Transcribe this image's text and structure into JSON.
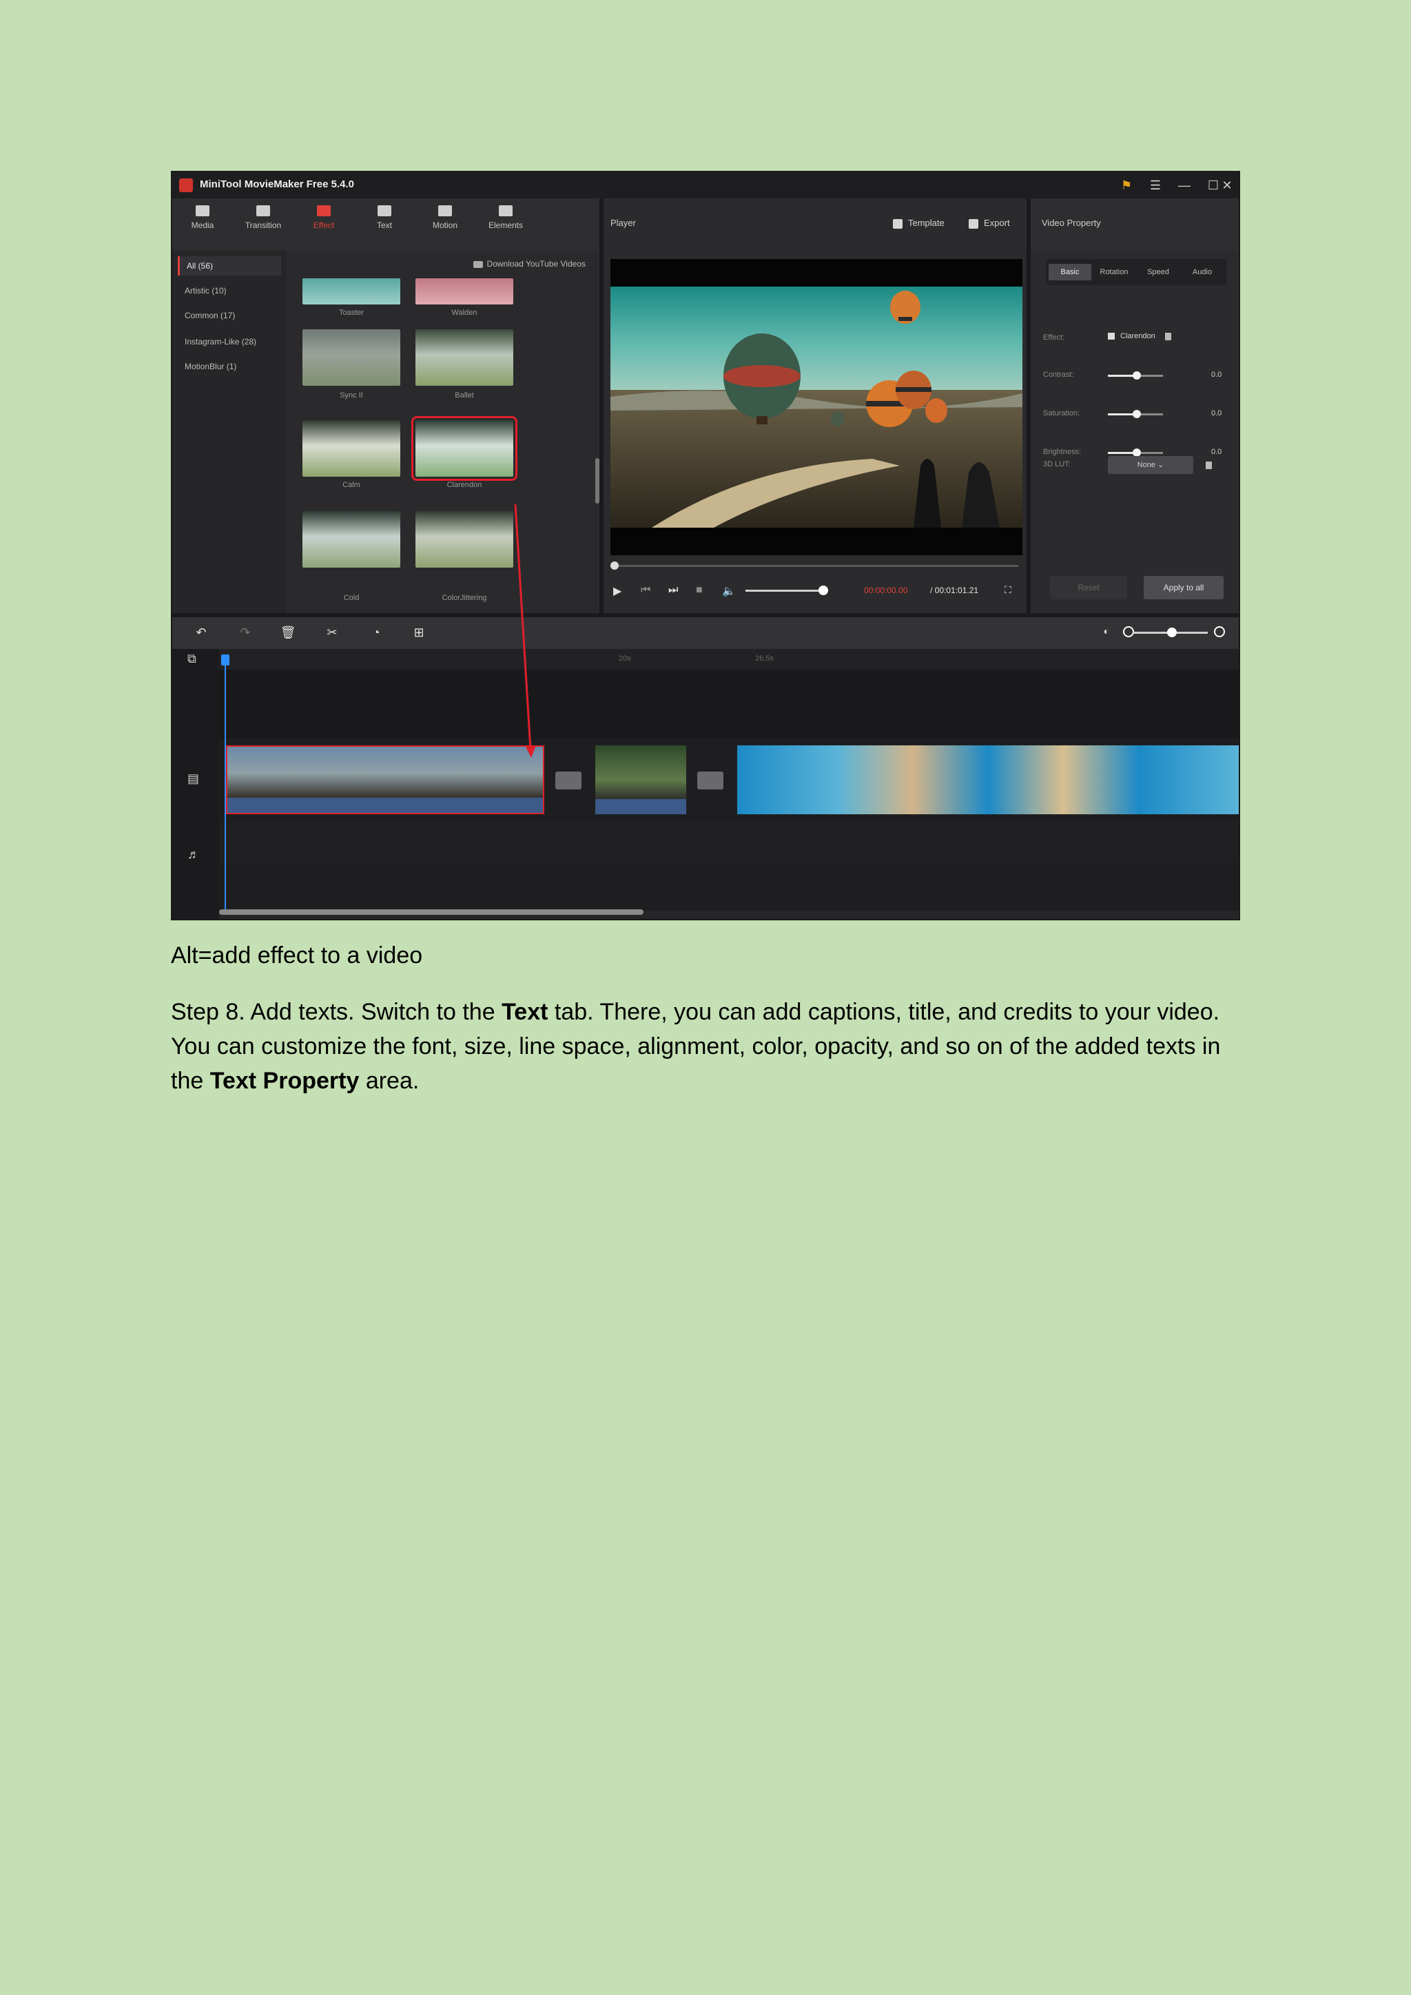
{
  "app": {
    "title": "MiniTool MovieMaker Free 5.4.0",
    "window_controls": [
      "key-icon",
      "menu-icon",
      "minimize-icon",
      "maximize-icon",
      "close-icon"
    ]
  },
  "toolbar": {
    "tabs": [
      {
        "label": "Media",
        "icon": "folder-icon"
      },
      {
        "label": "Transition",
        "icon": "transition-icon"
      },
      {
        "label": "Effect",
        "icon": "effect-icon",
        "active": true
      },
      {
        "label": "Text",
        "icon": "text-icon"
      },
      {
        "label": "Motion",
        "icon": "motion-icon"
      },
      {
        "label": "Elements",
        "icon": "elements-icon"
      }
    ]
  },
  "effects": {
    "categories": [
      {
        "label": "All (56)",
        "active": true
      },
      {
        "label": "Artistic (10)"
      },
      {
        "label": "Common (17)"
      },
      {
        "label": "Instagram-Like (28)"
      },
      {
        "label": "MotionBlur (1)"
      }
    ],
    "download_label": "Download YouTube Videos",
    "items": [
      "Toaster",
      "Walden",
      "Sync II",
      "Ballet",
      "Calm",
      "Clarendon",
      "Cold",
      "ColorJittering"
    ],
    "selected": "Clarendon"
  },
  "player": {
    "title": "Player",
    "template_label": "Template",
    "export_label": "Export",
    "time_current": "00:00:00.00",
    "time_total": "/ 00:01:01.21",
    "progress": 0.0,
    "volume": 1.0
  },
  "properties": {
    "title": "Video Property",
    "tabs": [
      "Basic",
      "Rotation",
      "Speed",
      "Audio"
    ],
    "active_tab": "Basic",
    "effect_label": "Effect:",
    "effect_value": "Clarendon",
    "contrast_label": "Contrast:",
    "contrast_value": "0.0",
    "saturation_label": "Saturation:",
    "saturation_value": "0.0",
    "brightness_label": "Brightness:",
    "brightness_value": "0.0",
    "lut_label": "3D LUT:",
    "lut_value": "None",
    "reset_label": "Reset",
    "apply_label": "Apply to all"
  },
  "timeline": {
    "ticks": [
      "20s",
      "26.5s"
    ],
    "tools": [
      "undo-icon",
      "redo-icon",
      "delete-icon",
      "split-icon",
      "speed-icon",
      "crop-icon"
    ]
  },
  "doc": {
    "caption": "Alt=add effect to a video",
    "para_1": "Step 8. Add texts. Switch to the ",
    "para_bold_1": "Text",
    "para_2": " tab. There, you can add captions, title, and credits to your video. You can customize the font, size, line space, alignment, color, opacity, and so on of the added texts in the ",
    "para_bold_2": "Text Property",
    "para_3": " area."
  },
  "colors": {
    "page_bg": "#c5e0b4",
    "accent": "#e0403a",
    "selection": "#e0202a",
    "playhead": "#2f8fff"
  }
}
